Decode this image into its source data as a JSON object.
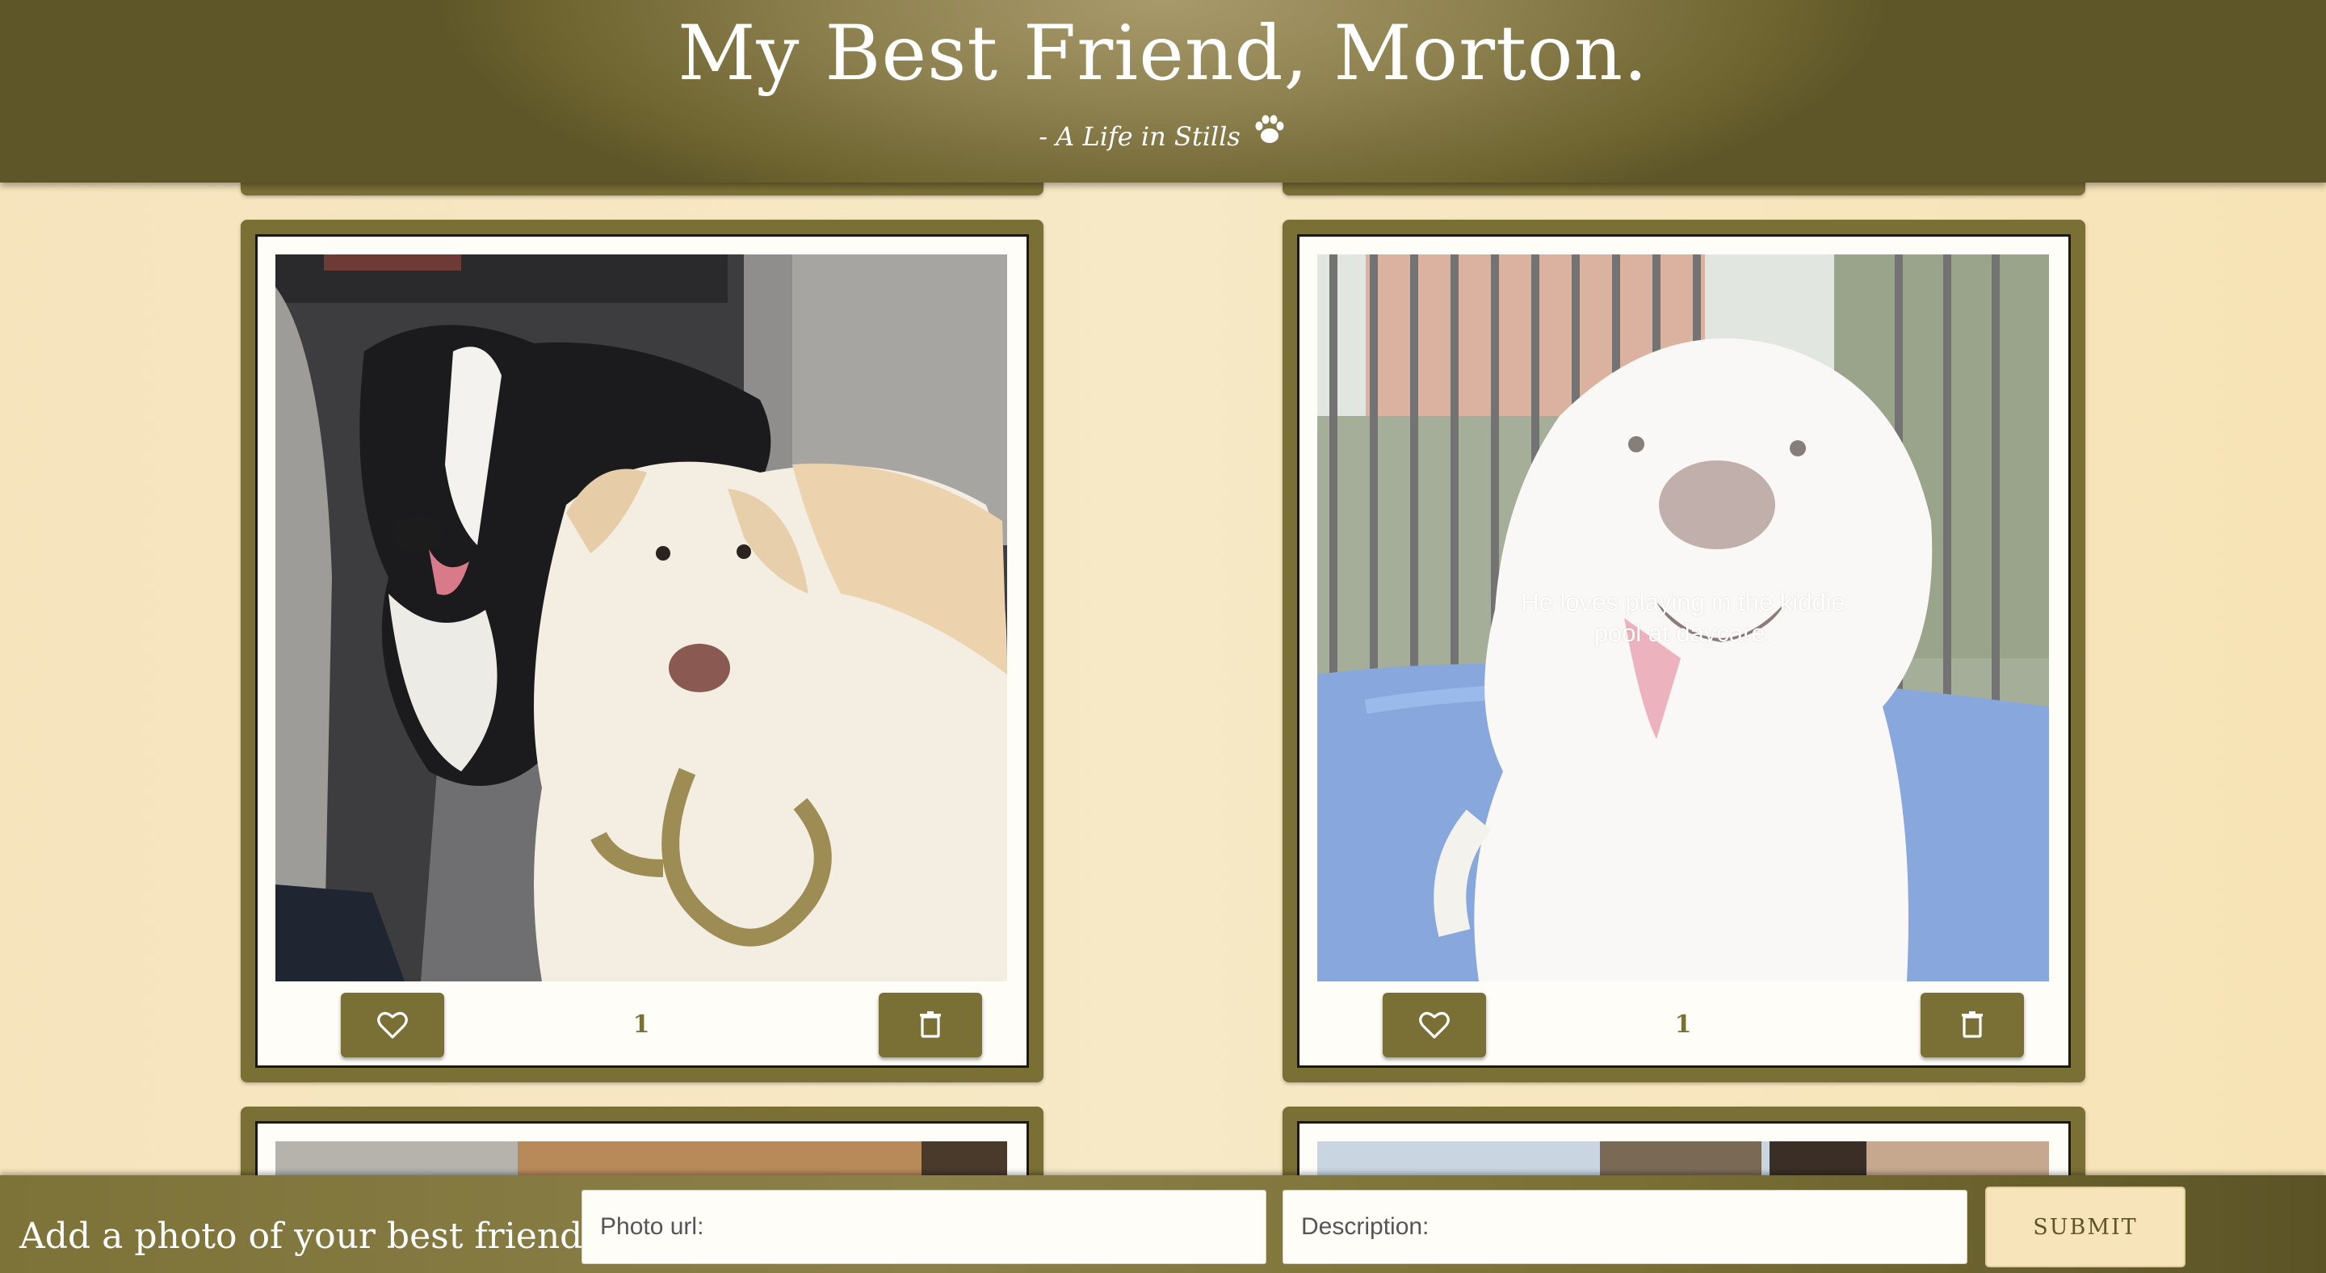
{
  "header": {
    "title": "My Best Friend, Morton.",
    "subtitle": "- A Life in Stills",
    "icon": "paw-icon"
  },
  "cards": [
    {
      "likes": "1",
      "caption": "",
      "photo": "two dogs in car seat"
    },
    {
      "likes": "1",
      "caption": "He loves playing in the kiddie pool at daycare.",
      "photo": "white dog by kiddie pool"
    }
  ],
  "buttons": {
    "like_icon": "heart-icon",
    "delete_icon": "trash-icon"
  },
  "form": {
    "label": "Add a photo of your best friend...",
    "url_placeholder": "Photo url:",
    "description_placeholder": "Description:",
    "submit_label": "SUBMIT"
  },
  "colors": {
    "accent": "#7a7035",
    "background": "#f7e6c0",
    "card_inner": "#fffdf8"
  }
}
